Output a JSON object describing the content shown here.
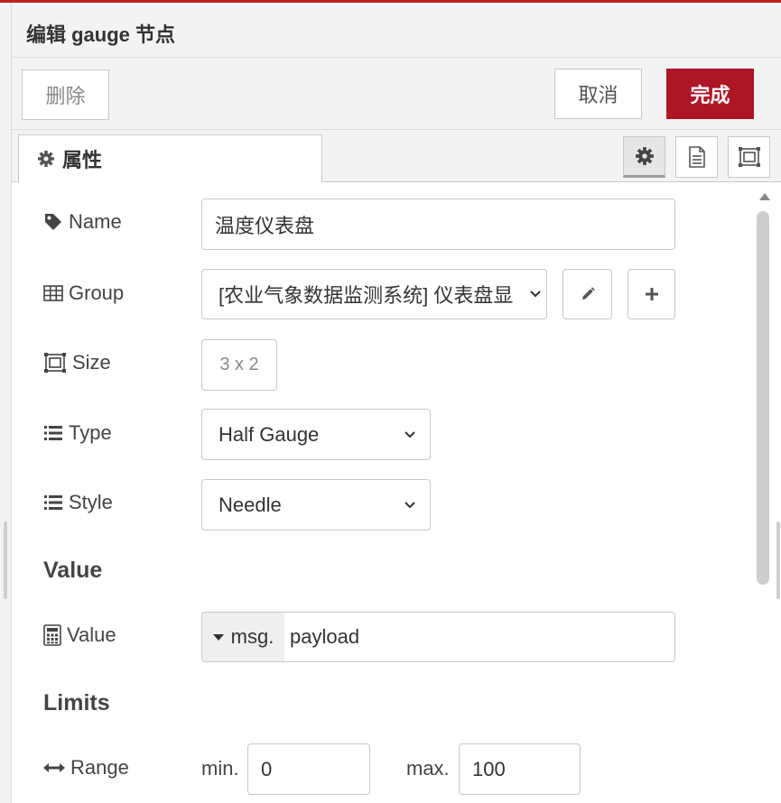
{
  "header": {
    "title": "编辑 gauge 节点"
  },
  "toolbar": {
    "delete_label": "删除",
    "cancel_label": "取消",
    "done_label": "完成"
  },
  "tabs": {
    "properties_label": "属性"
  },
  "form": {
    "name": {
      "label": "Name",
      "value": "温度仪表盘"
    },
    "group": {
      "label": "Group",
      "value": "[农业气象数据监测系统] 仪表盘显"
    },
    "size": {
      "label": "Size",
      "value": "3 x 2"
    },
    "type": {
      "label": "Type",
      "value": "Half Gauge"
    },
    "style": {
      "label": "Style",
      "value": "Needle"
    }
  },
  "sections": {
    "value_title": "Value",
    "limits_title": "Limits"
  },
  "value_field": {
    "label": "Value",
    "type": "msg.",
    "value": "payload"
  },
  "range": {
    "label": "Range",
    "min_label": "min.",
    "min_value": "0",
    "max_label": "max.",
    "max_value": "100"
  },
  "colors": {
    "accent": "#ad1625",
    "border": "#c8c8c8",
    "panel": "#f3f3f3"
  },
  "icons": [
    "gear-icon",
    "description-icon",
    "appearance-icon",
    "tag-icon",
    "table-icon",
    "size-icon",
    "list-icon",
    "calculator-icon",
    "arrows-horizontal-icon",
    "pencil-icon",
    "plus-icon",
    "caret-down-icon"
  ]
}
